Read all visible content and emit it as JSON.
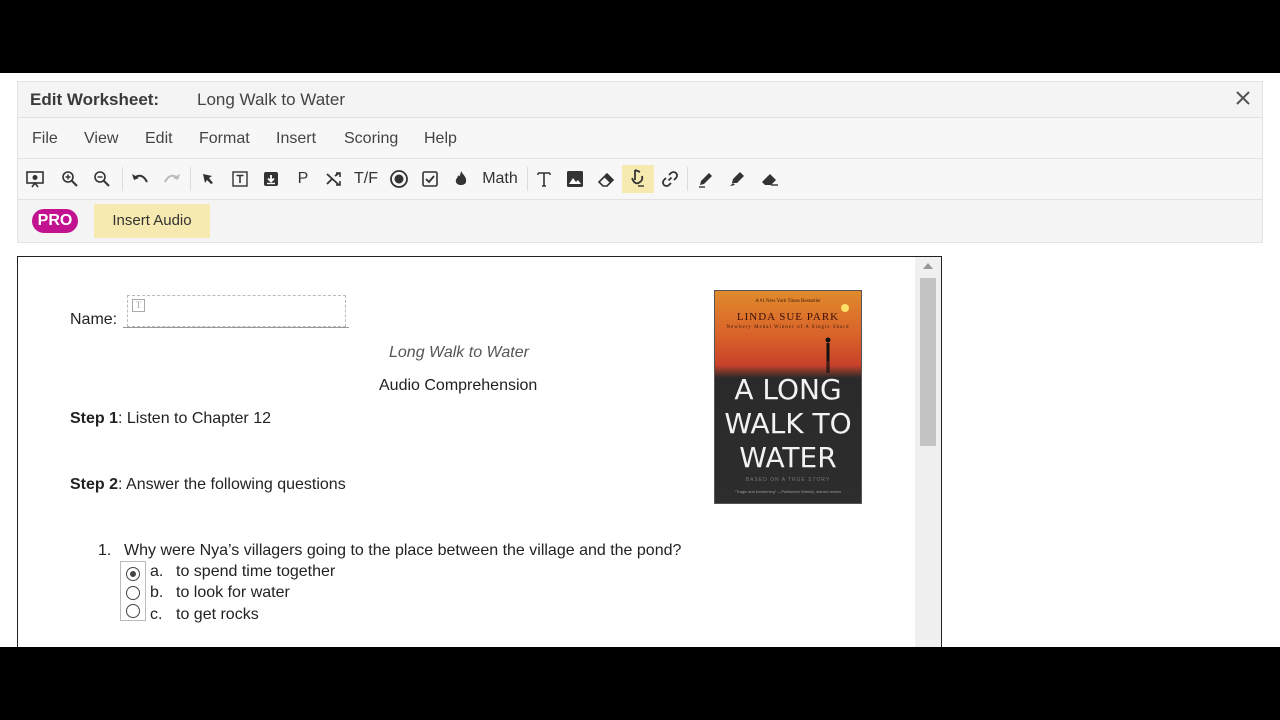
{
  "window": {
    "title_label": "Edit Worksheet:",
    "document_name": "Long Walk to Water"
  },
  "menu": [
    "File",
    "View",
    "Edit",
    "Format",
    "Insert",
    "Scoring",
    "Help"
  ],
  "toolbar": {
    "text_tools": {
      "p": "P",
      "tf": "T/F",
      "math": "Math"
    },
    "icons": [
      "presentation-icon",
      "zoom-in-icon",
      "zoom-out-icon",
      "undo-icon",
      "redo-icon",
      "select-arrow-icon",
      "text-box-icon",
      "download-box-icon",
      "paragraph-icon",
      "shuffle-icon",
      "true-false-tool",
      "radio-button-icon",
      "checkbox-icon",
      "flame-icon",
      "math-tool",
      "text-icon",
      "image-icon",
      "eraser-icon",
      "audio-icon",
      "link-icon",
      "pen-icon",
      "highlighter-icon",
      "eraser-fill-icon"
    ],
    "active_tool": "audio-icon"
  },
  "subbar": {
    "badge": "PRO",
    "insert_audio": "Insert Audio"
  },
  "worksheet": {
    "name_label": "Name:",
    "title": "Long Walk to Water",
    "subtitle": "Audio Comprehension",
    "step1_label": "Step 1",
    "step1_text": ": Listen to Chapter 12",
    "step2_label": "Step 2",
    "step2_text": ": Answer the following questions",
    "question_number": "1.",
    "question_text": "Why were Nya’s villagers going to the place between the village and the pond?",
    "options": [
      {
        "letter": "a.",
        "text": "to spend time together",
        "selected": true
      },
      {
        "letter": "b.",
        "text": "to look for water",
        "selected": false
      },
      {
        "letter": "c.",
        "text": "to get rocks",
        "selected": false
      }
    ],
    "book_cover": {
      "tagline": "A #1 New York Times Bestseller",
      "author": "LINDA SUE PARK",
      "author_sub": "Newbery Medal Winner of A Single Shard",
      "title_lines": [
        "A LONG",
        "WALK TO",
        "WATER"
      ],
      "based": "BASED ON A TRUE STORY",
      "quote": "“Tragic and heartening” —Publishers Weekly, starred review"
    }
  },
  "colors": {
    "pro_badge": "#c2128f",
    "highlight": "#f7eab0"
  }
}
